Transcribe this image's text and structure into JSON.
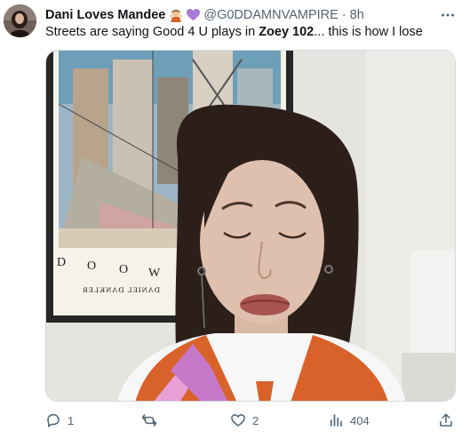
{
  "tweet": {
    "author_name": "Dani Loves Mandee",
    "author_emojis": [
      "woman-gesturing-icon",
      "purple-heart-icon"
    ],
    "handle": "@G0DDAMNVAMPIRE",
    "separator": "·",
    "time": "8h",
    "text_before": "Streets are saying Good 4 U plays in ",
    "text_bold": "Zoey 102",
    "text_after": "... this is how I lose",
    "poster_text": "DANIEL DANKLER",
    "poster_letters": [
      "D",
      "O",
      "O",
      "W"
    ]
  },
  "actions": {
    "reply_count": "1",
    "retweet_count": "",
    "like_count": "2",
    "views_count": "404"
  },
  "colors": {
    "text_primary": "#0f1419",
    "text_secondary": "#536471",
    "border": "#cfd9de",
    "vest_orange": "#d9622b",
    "vest_pink": "#c678c9"
  }
}
